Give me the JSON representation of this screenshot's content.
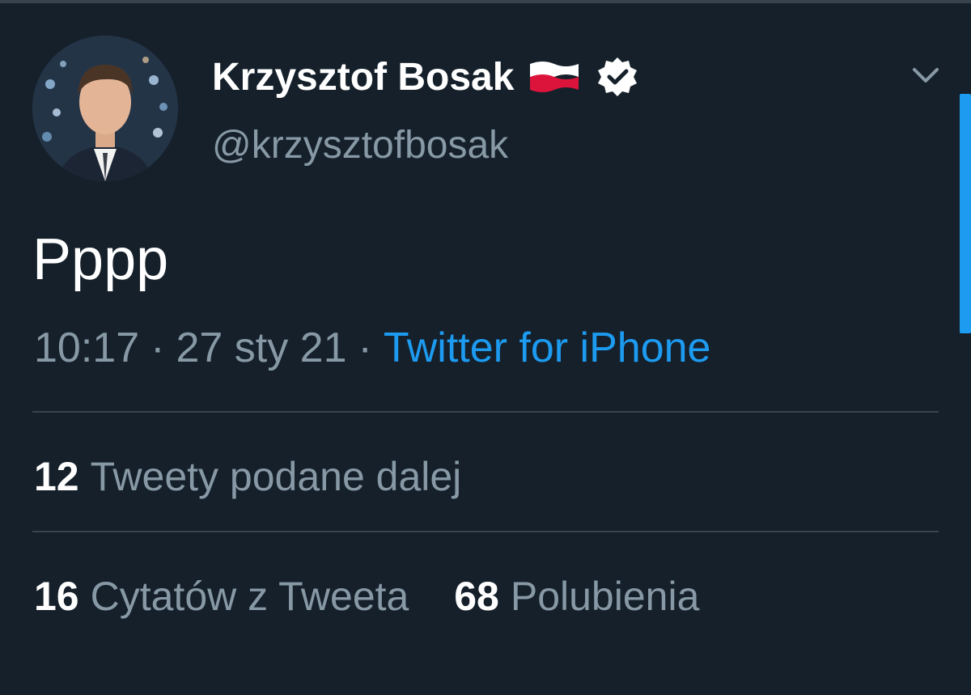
{
  "author": {
    "display_name": "Krzysztof Bosak",
    "handle": "@krzysztofbosak",
    "flag_icon": "poland-flag-icon",
    "verified_icon": "verified-badge-icon"
  },
  "tweet": {
    "text": "Pppp",
    "time": "10:17",
    "separator": "·",
    "date": "27 sty 21",
    "source": "Twitter for iPhone"
  },
  "stats": {
    "retweets": {
      "count": "12",
      "label": "Tweety podane dalej"
    },
    "quotes": {
      "count": "16",
      "label": "Cytatów z Tweeta"
    },
    "likes": {
      "count": "68",
      "label": "Polubienia"
    }
  },
  "colors": {
    "background": "#15202b",
    "accent": "#1d9bf0",
    "secondary_text": "#8899a6",
    "divider": "#38444d"
  }
}
